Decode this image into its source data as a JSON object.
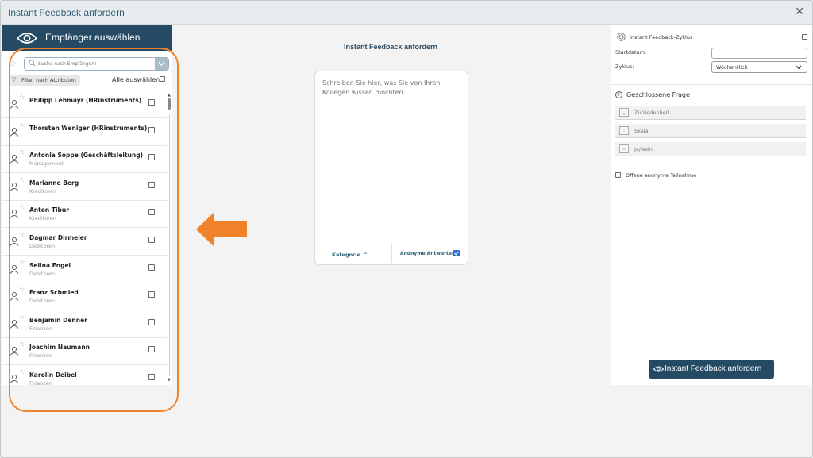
{
  "window": {
    "title": "Instant Feedback anfordern",
    "close_glyph": "✕"
  },
  "left": {
    "header_label": "Empfänger auswählen",
    "search_placeholder": "Suche nach Empfängern",
    "filter_label": "Filter nach Attributen",
    "select_all_label": "Alle auswählen",
    "recipients": [
      {
        "name": "Philipp Lehmayr (HRinstruments)",
        "dept": ""
      },
      {
        "name": "Thorsten Weniger (HRinstruments)",
        "dept": ""
      },
      {
        "name": "Antonia Soppe (Geschäftsleitung)",
        "dept": "Management"
      },
      {
        "name": "Marianne Berg",
        "dept": "Kreditoren"
      },
      {
        "name": "Anton Tibur",
        "dept": "Kreditoren"
      },
      {
        "name": "Dagmar Dirmeier",
        "dept": "Debitoren"
      },
      {
        "name": "Selina Engel",
        "dept": "Debitoren"
      },
      {
        "name": "Franz Schmied",
        "dept": "Debitoren"
      },
      {
        "name": "Benjamin Denner",
        "dept": "Finanzen"
      },
      {
        "name": "Joachim Naumann",
        "dept": "Finanzen"
      },
      {
        "name": "Karolin Deibel",
        "dept": "Finanzen"
      }
    ]
  },
  "middle": {
    "title": "Instant Feedback anfordern",
    "message_placeholder": "Schreiben Sie hier, was Sie von Ihren Kollegen wissen möchten...",
    "category_label": "Kategorie",
    "anonymous_label": "Anonyme Antworten",
    "anonymous_checked": true
  },
  "right": {
    "cycle_label": "Instant Feedback-Zyklus",
    "start_label": "Startdatum:",
    "cycle_select_label": "Zyklus:",
    "cycle_value": "Wöchentlich",
    "closed_question_label": "Geschlossene Frage",
    "options": [
      {
        "label": "Zufriedenheit",
        "icon": "smiley-icon"
      },
      {
        "label": "Skala",
        "icon": "scale-icon"
      },
      {
        "label": "Ja/Nein",
        "icon": "yes-no-icon"
      }
    ],
    "open_anonymous_label": "Offene anonyme Teilnahme",
    "submit_label": "Instant Feedback anfordern"
  },
  "colors": {
    "primary": "#254a64",
    "accent": "#f0822a",
    "checkbox_blue": "#2f6fd1"
  }
}
